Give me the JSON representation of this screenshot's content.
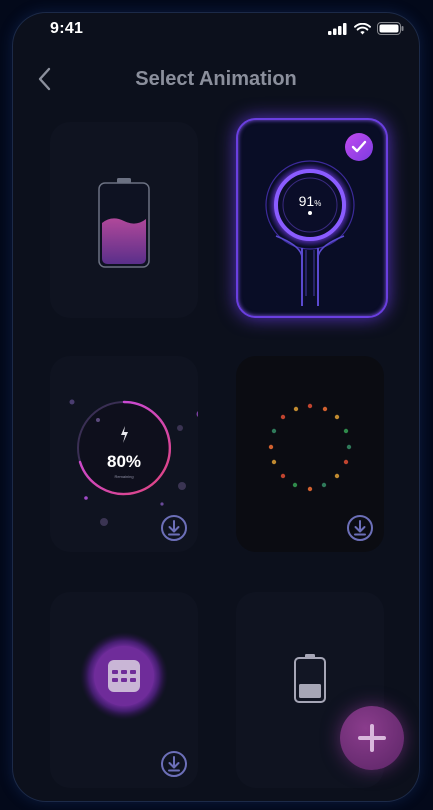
{
  "status_bar": {
    "time": "9:41"
  },
  "header": {
    "title": "Select Animation"
  },
  "cards": [
    {
      "id": "battery-fill"
    },
    {
      "id": "ring-91",
      "value": "91",
      "unit": "%",
      "selected": true
    },
    {
      "id": "ring-80",
      "value": "80%",
      "sub": "Remaining"
    },
    {
      "id": "dots-circle"
    },
    {
      "id": "keypad-glow"
    },
    {
      "id": "mini-battery"
    }
  ],
  "colors": {
    "accent": "#7b3be0",
    "fab": "#7a347e"
  }
}
